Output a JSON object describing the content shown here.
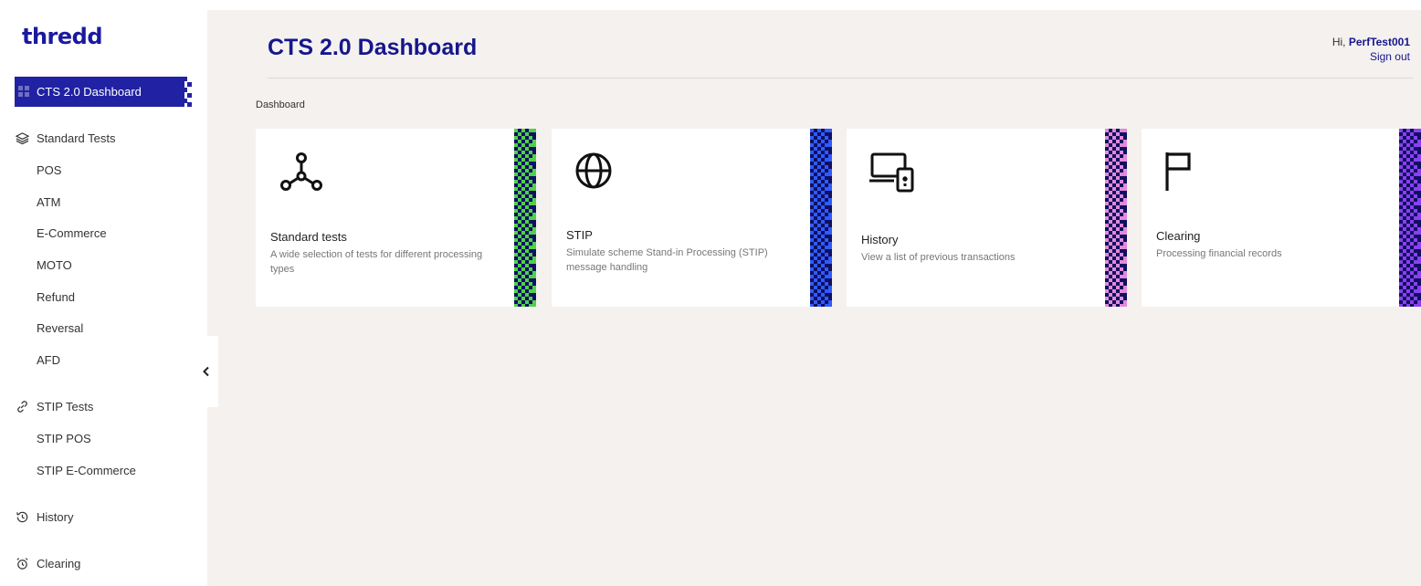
{
  "brand": {
    "logo": "thredd"
  },
  "sidebar": {
    "active": {
      "label": "CTS 2.0 Dashboard"
    },
    "sections": [
      {
        "label": "Standard Tests",
        "icon": "layers-icon",
        "items": [
          "POS",
          "ATM",
          "E-Commerce",
          "MOTO",
          "Refund",
          "Reversal",
          "AFD"
        ]
      },
      {
        "label": "STIP Tests",
        "icon": "link-icon",
        "items": [
          "STIP POS",
          "STIP E-Commerce"
        ]
      },
      {
        "label": "History",
        "icon": "history-icon",
        "items": []
      },
      {
        "label": "Clearing",
        "icon": "alarm-clock-icon",
        "items": []
      }
    ],
    "collapse_icon": "chevron-left-icon"
  },
  "header": {
    "title": "CTS 2.0 Dashboard",
    "greeting_prefix": "Hi,",
    "username": "PerfTest001",
    "signout": "Sign out"
  },
  "breadcrumb": "Dashboard",
  "cards": [
    {
      "title": "Standard tests",
      "description": "A wide selection of tests for different processing types",
      "icon": "network-nodes-icon",
      "accent": "#4fd14a"
    },
    {
      "title": "STIP",
      "description": "Simulate scheme Stand-in Processing (STIP) message handling",
      "icon": "globe-icon",
      "accent": "#2f5bff"
    },
    {
      "title": "History",
      "description": "View a list of previous transactions",
      "icon": "devices-icon",
      "accent": "#e28ad8"
    },
    {
      "title": "Clearing",
      "description": "Processing financial records",
      "icon": "flag-icon",
      "accent": "#8a3ff0"
    }
  ],
  "colors": {
    "primary": "#16168c",
    "nav_active": "#2121a3",
    "background": "#f4f1ef"
  }
}
